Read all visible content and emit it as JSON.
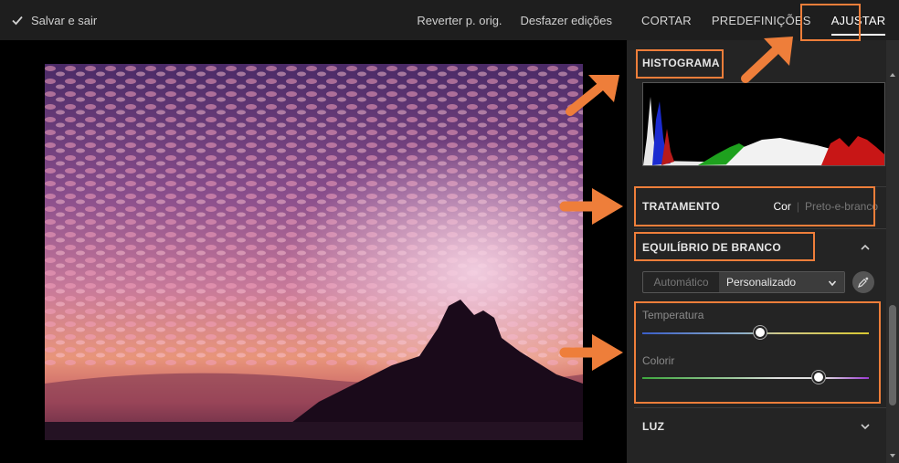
{
  "topbar": {
    "save_label": "Salvar e sair",
    "revert_label": "Reverter p. orig.",
    "undo_label": "Desfazer edições"
  },
  "tabs": [
    {
      "label": "CORTAR",
      "active": false
    },
    {
      "label": "PREDEFINIÇÕES",
      "active": false
    },
    {
      "label": "AJUSTAR",
      "active": true
    }
  ],
  "histogram": {
    "title": "HISTOGRAMA"
  },
  "treatment": {
    "title": "TRATAMENTO",
    "options": [
      "Cor",
      "Preto-e-branco"
    ],
    "selected": "Cor"
  },
  "white_balance": {
    "title": "EQUILÍBRIO DE BRANCO",
    "modes": [
      "Automático",
      "Personalizado"
    ],
    "selected": "Personalizado",
    "sliders": [
      {
        "label": "Temperatura",
        "value": 0.5
      },
      {
        "label": "Colorir",
        "value": 0.78
      }
    ]
  },
  "light": {
    "title": "LUZ"
  },
  "colors": {
    "accent": "#ee7e3a",
    "panel_bg": "#242424",
    "topbar_bg": "#1e1e1e"
  },
  "icons": {
    "save": "check-icon",
    "collapse": "chevron-up-icon",
    "expand": "chevron-down-icon",
    "dropdown": "chevron-down-icon",
    "eyedropper": "eyedropper-icon",
    "annotation": "arrow-icon"
  }
}
